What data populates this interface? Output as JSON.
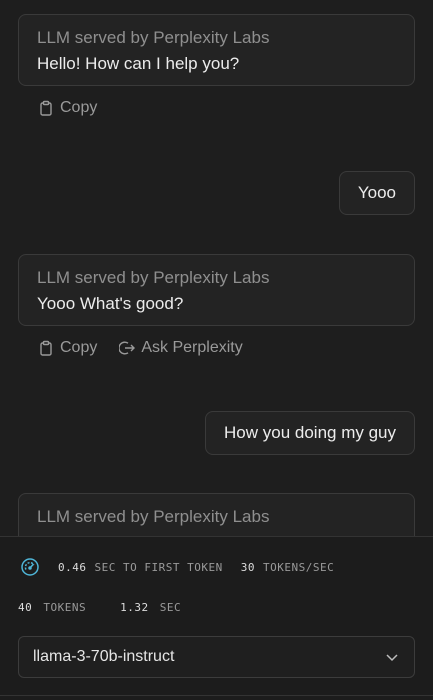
{
  "messages": [
    {
      "role": "assistant",
      "from": "LLM served by Perplexity Labs",
      "text": "Hello! How can I help you?",
      "actions": [
        "Copy"
      ]
    },
    {
      "role": "user",
      "text": "Yooo"
    },
    {
      "role": "assistant",
      "from": "LLM served by Perplexity Labs",
      "text": "Yooo What's good?",
      "actions": [
        "Copy",
        "Ask Perplexity"
      ]
    },
    {
      "role": "user",
      "text": "How you doing my guy"
    },
    {
      "role": "assistant",
      "from": "LLM served by Perplexity Labs",
      "text": ""
    }
  ],
  "stats": {
    "first_token_value": "0.46",
    "first_token_label": "SEC TO FIRST TOKEN",
    "tokens_per_sec_value": "30",
    "tokens_per_sec_label": "TOKENS/SEC",
    "tokens_value": "40",
    "tokens_label": "TOKENS",
    "seconds_value": "1.32",
    "seconds_label": "SEC"
  },
  "model_select": {
    "selected": "llama-3-70b-instruct"
  },
  "icons": {
    "speed": "speedometer-icon",
    "copy": "clipboard-icon",
    "ask": "arrow-out-icon",
    "chevron": "chevron-down-icon"
  },
  "colors": {
    "accent": "#4fb6d8",
    "background": "#1e1e1e",
    "bubble": "#232323"
  }
}
